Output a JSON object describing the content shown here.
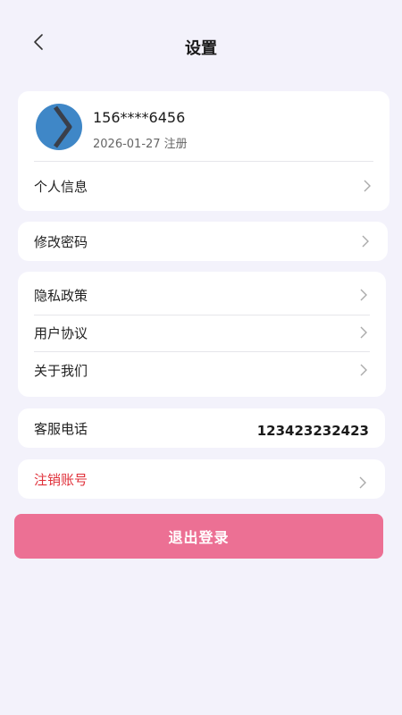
{
  "header": {
    "title": "设置"
  },
  "profile": {
    "phone": "156****6456",
    "register_date": "2026-01-27 注册",
    "personal_info_label": "个人信息"
  },
  "password": {
    "label": "修改密码"
  },
  "legal": {
    "privacy_label": "隐私政策",
    "agreement_label": "用户协议",
    "about_label": "关于我们"
  },
  "service": {
    "label": "客服电话",
    "phone": "123423232423"
  },
  "cancel_account": {
    "label": "注销账号",
    "color": "#e0303a"
  },
  "logout": {
    "label": "退出登录",
    "color": "#ec7094"
  },
  "icons": {
    "back": "chevron-left-icon",
    "row_arrow": "chevron-right-icon"
  }
}
